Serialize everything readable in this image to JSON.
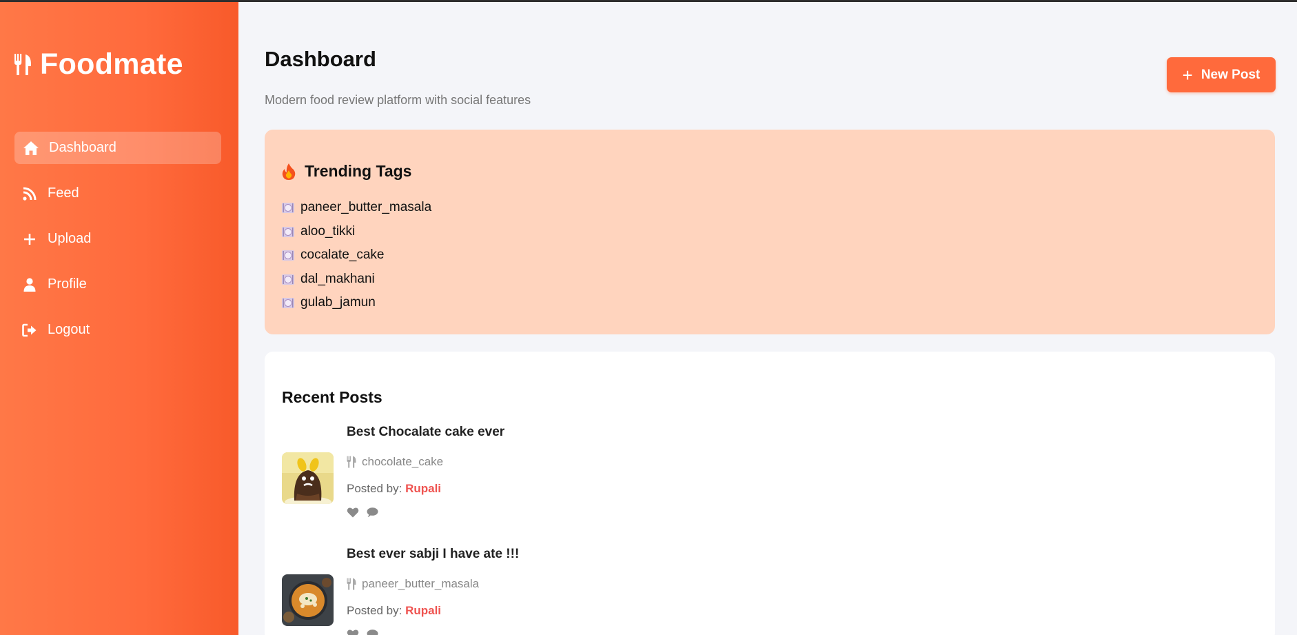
{
  "app": {
    "name": "Foodmate"
  },
  "sidebar": {
    "items": [
      {
        "label": "Dashboard",
        "icon": "home-icon",
        "active": true
      },
      {
        "label": "Feed",
        "icon": "rss-icon",
        "active": false
      },
      {
        "label": "Upload",
        "icon": "plus-icon",
        "active": false
      },
      {
        "label": "Profile",
        "icon": "user-icon",
        "active": false
      },
      {
        "label": "Logout",
        "icon": "logout-icon",
        "active": false
      }
    ]
  },
  "header": {
    "title": "Dashboard",
    "subtitle": "Modern food review platform with social features",
    "new_post_label": "New Post"
  },
  "trending": {
    "title": "Trending Tags",
    "tags": [
      "paneer_butter_masala",
      "aloo_tikki",
      "cocalate_cake",
      "dal_makhani",
      "gulab_jamun"
    ]
  },
  "recent": {
    "title": "Recent Posts",
    "posted_by_label": "Posted by:",
    "posts": [
      {
        "title": "Best Chocalate cake ever",
        "tag": "chocolate_cake",
        "author": "Rupali"
      },
      {
        "title": "Best ever sabji I have ate !!!",
        "tag": "paneer_butter_masala",
        "author": "Rupali"
      }
    ]
  },
  "colors": {
    "accent": "#ff6a3c",
    "sidebar_start": "#ff7847",
    "sidebar_end": "#f85a2a",
    "trending_bg": "#ffd4be",
    "author": "#ef5350",
    "page_bg": "#f4f5f9"
  }
}
